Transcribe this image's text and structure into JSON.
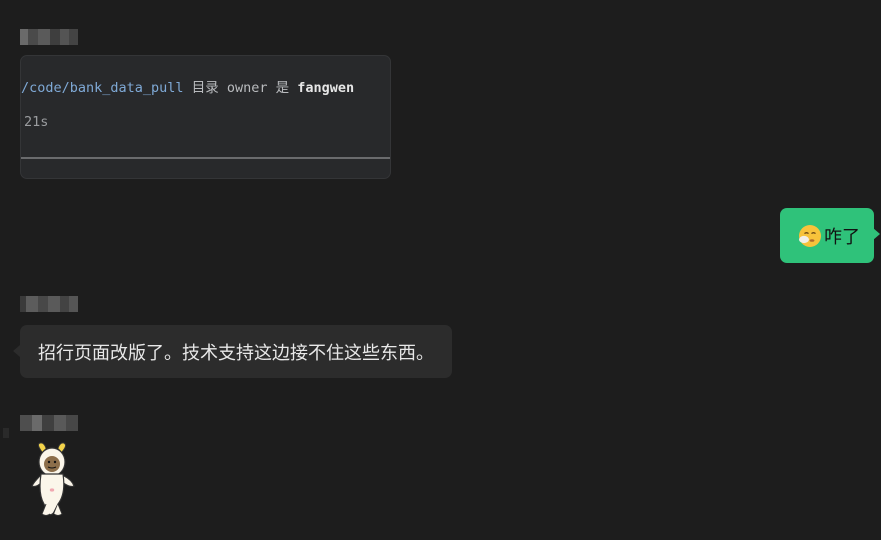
{
  "messages": {
    "code_block": {
      "path": "/code/bank_data_pull",
      "text_mid": " 目录 owner 是 ",
      "owner": "fangwen",
      "duration": "21s"
    },
    "outgoing": {
      "emoji": "face-with-hand-over-mouth-icon",
      "text": "咋了"
    },
    "incoming": {
      "text": "招行页面改版了。技术支持这边接不住这些东西。"
    },
    "sticker": {
      "icon": "cartoon-character-sticker"
    }
  },
  "colors": {
    "background": "#1d1d1d",
    "outgoing_bubble": "#2fc27a",
    "incoming_bubble": "#2c2c2c",
    "code_path": "#7fa9d6"
  }
}
